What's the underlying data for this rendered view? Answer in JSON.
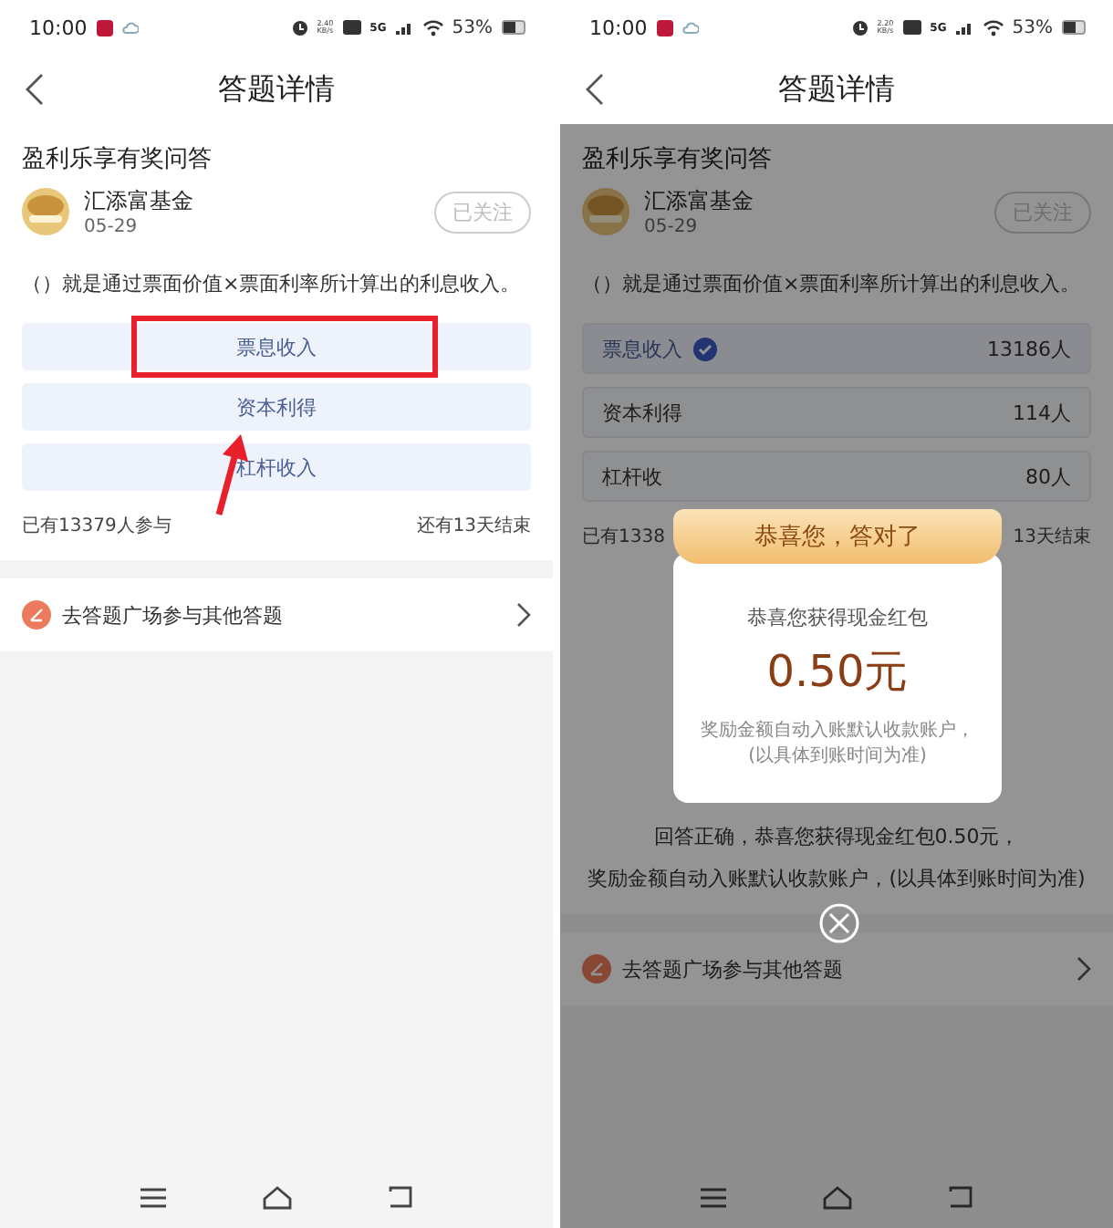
{
  "screens": [
    {
      "status_bar": {
        "time": "10:00",
        "speed_value": "2.40",
        "speed_unit": "KB/s",
        "network": "5G",
        "battery": "53%"
      },
      "nav": {
        "title": "答题详情"
      },
      "quiz": {
        "section_title": "盈利乐享有奖问答",
        "publisher": {
          "name": "汇添富基金",
          "date": "05-29"
        },
        "follow_button": "已关注",
        "question": "（）就是通过票面价值×票面利率所计算出的利息收入。",
        "options": [
          {
            "label": "票息收入",
            "highlighted": true
          },
          {
            "label": "资本利得",
            "highlighted": false
          },
          {
            "label": "杠杆收入",
            "highlighted": false
          }
        ],
        "participants": "已有13379人参与",
        "remaining": "还有13天结束"
      },
      "link": {
        "label": "去答题广场参与其他答题"
      }
    },
    {
      "status_bar": {
        "time": "10:00",
        "speed_value": "2.20",
        "speed_unit": "KB/s",
        "network": "5G",
        "battery": "53%"
      },
      "nav": {
        "title": "答题详情"
      },
      "dimmed": true,
      "quiz": {
        "section_title": "盈利乐享有奖问答",
        "publisher": {
          "name": "汇添富基金",
          "date": "05-29"
        },
        "follow_button": "已关注",
        "question": "（）就是通过票面价值×票面利率所计算出的利息收入。",
        "options": [
          {
            "label": "票息收入",
            "selected": true,
            "count": "13186人"
          },
          {
            "label": "资本利得",
            "selected": false,
            "count": "114人"
          },
          {
            "label": "杠杆收",
            "selected": false,
            "count": "80人"
          }
        ],
        "participants": "已有1338",
        "remaining": "13天结束"
      },
      "result_lines": [
        "回答正确，恭喜您获得现金红包0.50元，",
        "奖励金额自动入账默认收款账户，(以具体到账时间为准)"
      ],
      "link": {
        "label": "去答题广场参与其他答题"
      },
      "popup": {
        "ribbon": "恭喜您，答对了",
        "headline": "恭喜您获得现金红包",
        "amount": "0.50元",
        "note_lines": [
          "奖励金额自动入账默认收款账户，",
          "(以具体到账时间为准)"
        ]
      }
    }
  ]
}
